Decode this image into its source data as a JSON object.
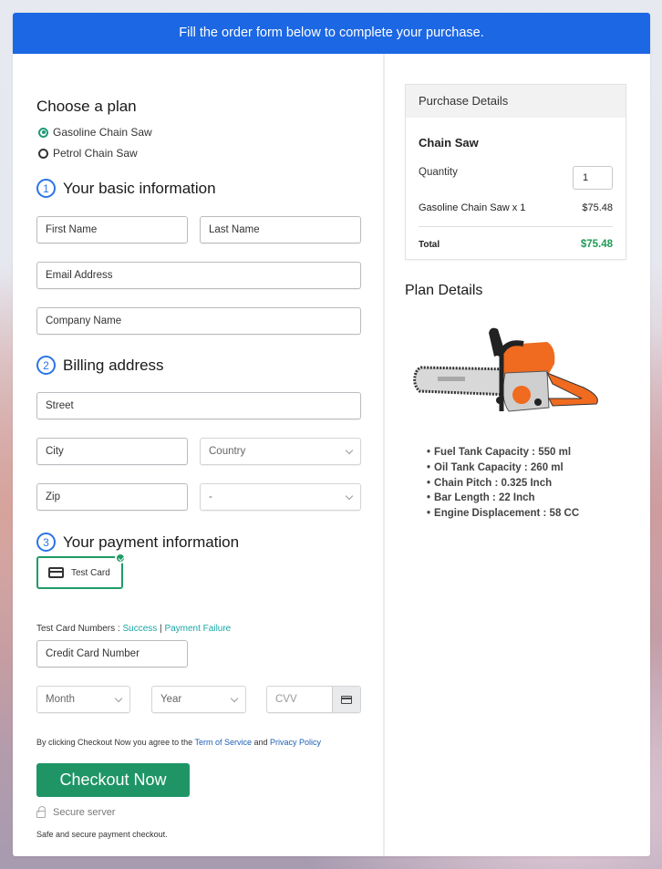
{
  "banner": {
    "text": "Fill the order form below to complete your purchase."
  },
  "plan": {
    "heading": "Choose a plan",
    "options": [
      {
        "label": "Gasoline Chain Saw",
        "selected": true
      },
      {
        "label": "Petrol Chain Saw",
        "selected": false
      }
    ]
  },
  "basic_info": {
    "number": "1",
    "heading": "Your basic information",
    "first_name": "First Name",
    "last_name": "Last Name",
    "email": "Email Address",
    "company": "Company Name"
  },
  "billing": {
    "number": "2",
    "heading": "Billing address",
    "street": "Street",
    "city": "City",
    "country": "Country",
    "zip": "Zip",
    "state": "-"
  },
  "payment": {
    "number": "3",
    "heading": "Your payment information",
    "method_label": "Test Card",
    "test_numbers_label": "Test Card Numbers : ",
    "success_link": "Success",
    "separator": " | ",
    "failure_link": "Payment Failure",
    "card_number": "Credit Card Number",
    "month": "Month",
    "year": "Year",
    "cvv": "CVV"
  },
  "agreement": {
    "prefix": "By clicking Checkout Now you agree to the ",
    "tos_link": "Term of Service",
    "middle": " and ",
    "privacy_link": "Privacy Policy"
  },
  "checkout_button": "Checkout Now",
  "secure_server": "Secure server",
  "safe_text": "Safe and secure payment checkout.",
  "purchase": {
    "heading": "Purchase Details",
    "product": "Chain Saw",
    "quantity_label": "Quantity",
    "quantity_value": "1",
    "line_item": "Gasoline Chain Saw x 1",
    "line_price": "$75.48",
    "total_label": "Total",
    "total_value": "$75.48"
  },
  "plan_details": {
    "heading": "Plan Details",
    "image_alt": "chainsaw",
    "specs": [
      "Fuel Tank Capacity : 550 ml",
      "Oil Tank Capacity : 260 ml",
      "Chain Pitch : 0.325 Inch",
      "Bar Length : 22 Inch",
      "Engine Displacement : 58 CC"
    ]
  },
  "colors": {
    "banner": "#1c67e3",
    "accent_green": "#1f9566",
    "total_green": "#1f9b55",
    "link_teal": "#1ba6a6",
    "link_blue": "#1d5fb8",
    "step_blue": "#2a74e6"
  }
}
